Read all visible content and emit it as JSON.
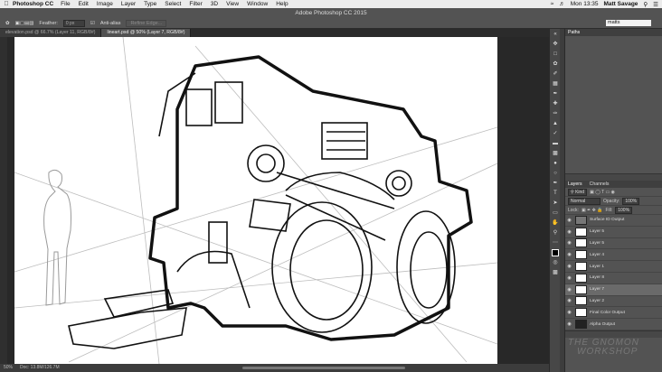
{
  "menubar": {
    "app": "Photoshop CC",
    "items": [
      "File",
      "Edit",
      "Image",
      "Layer",
      "Type",
      "Select",
      "Filter",
      "3D",
      "View",
      "Window",
      "Help"
    ],
    "clock": "Mon 13:35",
    "user": "Matt Savage"
  },
  "options": {
    "window_title": "Adobe Photoshop CC 2015",
    "feather_label": "Feather:",
    "feather_value": "0 px",
    "antialias": "Anti-alias",
    "refine": "Refine Edge...",
    "workspace": "matts"
  },
  "tabs": [
    {
      "label": "elevation.psd @ 66.7% (Layer 11, RGB/8#)"
    },
    {
      "label": "lineart.psd @ 50% (Layer 7, RGB/8#)"
    }
  ],
  "status": {
    "zoom": "50%",
    "doc": "Doc: 13.8M/126.7M"
  },
  "paths_panel": {
    "title": "Paths"
  },
  "layers_panel": {
    "tabs": [
      "Layers",
      "Channels"
    ],
    "kind": "Kind",
    "blend": "Normal",
    "opacity_label": "Opacity:",
    "opacity_value": "100%",
    "lock_label": "Lock:",
    "fill_label": "Fill:",
    "fill_value": "100%",
    "layers": [
      {
        "name": "Surface ID Output"
      },
      {
        "name": "Layer 5"
      },
      {
        "name": "Layer 5"
      },
      {
        "name": "Layer 4"
      },
      {
        "name": "Layer 1"
      },
      {
        "name": "Layer 8"
      },
      {
        "name": "Layer 7"
      },
      {
        "name": "Layer 2"
      },
      {
        "name": "Final Color Output"
      },
      {
        "name": "Alpha Output"
      }
    ]
  },
  "watermark": {
    "line1": "THE GNOMON",
    "line2": "WORKSHOP"
  }
}
